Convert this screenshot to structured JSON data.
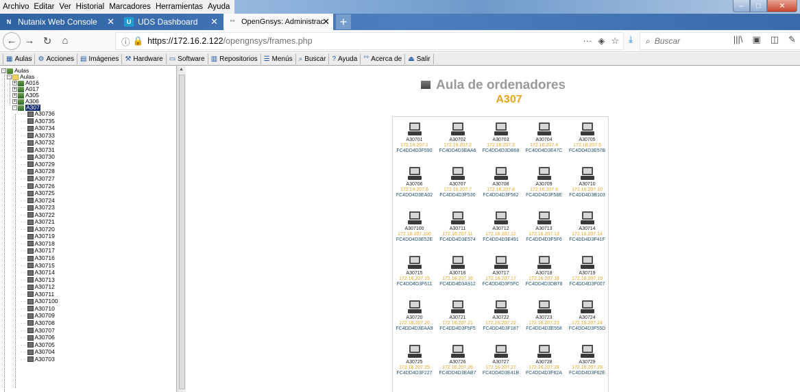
{
  "menu": [
    "Archivo",
    "Editar",
    "Ver",
    "Historial",
    "Marcadores",
    "Herramientas",
    "Ayuda"
  ],
  "tabs": [
    {
      "label": "Nutanix Web Console",
      "icon": "nutanix-icon",
      "active": false
    },
    {
      "label": "UDS Dashboard",
      "icon": "uds-icon",
      "active": false
    },
    {
      "label": "OpenGnsys: Administración web",
      "icon": "opengnsys-icon",
      "active": true
    }
  ],
  "url": {
    "host": "https://172.16.2.122",
    "path": "/opengnsys/frames.php"
  },
  "search": {
    "placeholder": "Buscar"
  },
  "toolbar": [
    "Aulas",
    "Acciones",
    "Imágenes",
    "Hardware",
    "Software",
    "Repositorios",
    "Menús",
    "Buscar",
    "Ayuda",
    "Acerca de",
    "Salir"
  ],
  "tree": {
    "root": "Aulas",
    "folder": "Aulas",
    "rooms": [
      "A016",
      "A017",
      "A305",
      "A306",
      "A307"
    ],
    "selected_room": "A307",
    "pcs": [
      "A30736",
      "A30735",
      "A30734",
      "A30733",
      "A30732",
      "A30731",
      "A30730",
      "A30729",
      "A30728",
      "A30727",
      "A30726",
      "A30725",
      "A30724",
      "A30723",
      "A30722",
      "A30721",
      "A30720",
      "A30719",
      "A30718",
      "A30717",
      "A30716",
      "A30715",
      "A30714",
      "A30713",
      "A30712",
      "A30711",
      "A307100",
      "A30710",
      "A30709",
      "A30708",
      "A30707",
      "A30706",
      "A30705",
      "A30704",
      "A30703"
    ]
  },
  "main": {
    "title": "Aula de ordenadores",
    "room": "A307",
    "computers": [
      {
        "name": "A30701",
        "ip": "172.16.207.1",
        "mac": "FC4DD4D3F590"
      },
      {
        "name": "A30702",
        "ip": "172.16.207.2",
        "mac": "FC4DD4D3EAA6"
      },
      {
        "name": "A30703",
        "ip": "172.16.207.3",
        "mac": "FC4DD4D3DB68"
      },
      {
        "name": "A30704",
        "ip": "172.16.207.4",
        "mac": "FC4DD4D3E47C"
      },
      {
        "name": "A30705",
        "ip": "172.16.207.5",
        "mac": "FC4DD4D3E57B"
      },
      {
        "name": "A30706",
        "ip": "172.16.207.6",
        "mac": "FC4DD4D3EA02"
      },
      {
        "name": "A30707",
        "ip": "172.16.207.7",
        "mac": "FC4DD4D3F530"
      },
      {
        "name": "A30708",
        "ip": "172.16.207.8",
        "mac": "FC4DD4D3F562"
      },
      {
        "name": "A30709",
        "ip": "172.16.207.9",
        "mac": "FC4DD4D3F58E"
      },
      {
        "name": "A30710",
        "ip": "172.16.207.10",
        "mac": "FC4DD4D3B103"
      },
      {
        "name": "A307100",
        "ip": "172.16.207.100",
        "mac": "FC4DD4D3E52E"
      },
      {
        "name": "A30711",
        "ip": "172.16.207.11",
        "mac": "FC4DD4D3E574"
      },
      {
        "name": "A30712",
        "ip": "172.16.207.12",
        "mac": "FC4DD4D3E491"
      },
      {
        "name": "A30713",
        "ip": "172.16.207.13",
        "mac": "FC4DD4D3F5F6"
      },
      {
        "name": "A30714",
        "ip": "172.16.207.14",
        "mac": "FC4DD4D3F41F"
      },
      {
        "name": "A30715",
        "ip": "172.16.207.15",
        "mac": "FC4DD4D3F611"
      },
      {
        "name": "A30716",
        "ip": "172.16.207.16",
        "mac": "FC4DD4D3A912"
      },
      {
        "name": "A30717",
        "ip": "172.16.207.17",
        "mac": "FC4DD4D3F5FC"
      },
      {
        "name": "A30718",
        "ip": "172.16.207.18",
        "mac": "FC4DD4D3DB78"
      },
      {
        "name": "A30719",
        "ip": "172.16.207.19",
        "mac": "FC4DD4D3F007"
      },
      {
        "name": "A30720",
        "ip": "172.16.207.20",
        "mac": "FC4DD4D3EAA9"
      },
      {
        "name": "A30721",
        "ip": "172.16.207.21",
        "mac": "FC4DD4D3F5F5"
      },
      {
        "name": "A30722",
        "ip": "172.16.207.22",
        "mac": "FC4DD4D3F187"
      },
      {
        "name": "A30723",
        "ip": "172.16.207.23",
        "mac": "FC4DD4D3E558"
      },
      {
        "name": "A30724",
        "ip": "172.16.207.24",
        "mac": "FC4DD4D3F55D"
      },
      {
        "name": "A30725",
        "ip": "172.16.207.25",
        "mac": "FC4DD4D3F227"
      },
      {
        "name": "A30726",
        "ip": "172.16.207.26",
        "mac": "FC4DD4D3EAB7"
      },
      {
        "name": "A30727",
        "ip": "172.16.207.27",
        "mac": "FC4DD4D3E41B"
      },
      {
        "name": "A30728",
        "ip": "172.16.207.28",
        "mac": "FC4DD4D3F62A"
      },
      {
        "name": "A30729",
        "ip": "172.16.207.29",
        "mac": "FC4DD4D3F62E"
      }
    ]
  }
}
